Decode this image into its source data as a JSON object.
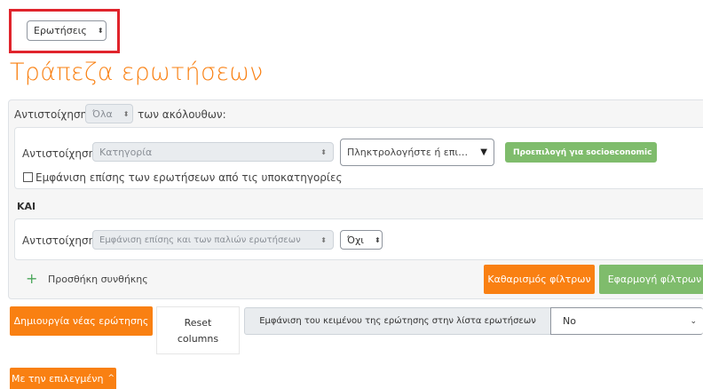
{
  "top_select": {
    "value": "Ερωτήσεις",
    "arrow": "⬍"
  },
  "page_title": "Τράπεζα ερωτήσεων",
  "filter": {
    "match_label": "Αντιστοίχηση",
    "match_all_value": "Όλα",
    "match_all_suffix": "των ακόλουθων:",
    "condition1": {
      "label": "Αντιστοίχηση",
      "type_value": "Κατηγορία",
      "search_placeholder": "Πληκτρολογήστε ή επιλέξτε...",
      "badge_label": "Προεπιλογή για socioeconomic",
      "badge_close": "✕",
      "subcat_label": "Εμφάνιση επίσης των ερωτήσεων από τις υποκατηγορίες"
    },
    "join_label": "ΚΑΙ",
    "condition2": {
      "label": "Αντιστοίχηση",
      "type_value": "Εμφάνιση επίσης και των παλιών ερωτήσεων",
      "value": "Όχι"
    },
    "add_condition_label": "Προσθήκη συνθήκης",
    "add_icon": "+",
    "clear_label": "Καθαρισμός φίλτρων",
    "apply_label": "Εφαρμογή φίλτρων"
  },
  "create_question_label": "Δημιουργία νέας ερώτησης",
  "reset_columns_label_line1": "Reset",
  "reset_columns_label_line2": "columns",
  "show_text": {
    "label": "Εμφάνιση του κειμένου της ερώτησης στην λίστα ερωτήσεων",
    "value": "No"
  },
  "with_selected_label": "Με την επιλεγμένη",
  "colors": {
    "accent": "#f98012",
    "green": "#7fbc6c",
    "highlight": "#e0242c"
  }
}
